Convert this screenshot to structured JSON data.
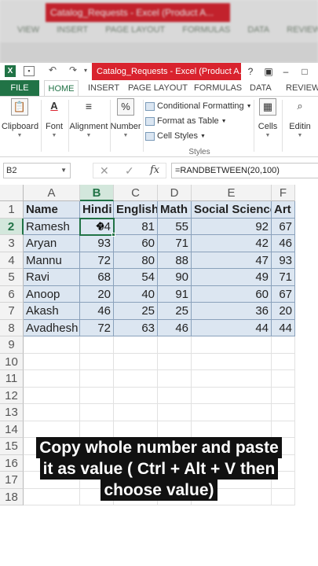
{
  "backdrop": {
    "title": "Catalog_Requests - Excel (Product A...",
    "tabs": [
      "VIEW",
      "INSERT",
      "PAGE LAYOUT",
      "FORMULAS",
      "DATA",
      "REVIEW"
    ]
  },
  "window": {
    "title": "Catalog_Requests - Excel (Product A...",
    "help": "?",
    "brand_color": "#217346",
    "title_color": "#d9232e"
  },
  "tabs": [
    "FILE",
    "HOME",
    "INSERT",
    "PAGE LAYOUT",
    "FORMULAS",
    "DATA",
    "REVIEW"
  ],
  "ribbon": {
    "clipboard": "Clipboard",
    "font": "Font",
    "alignment": "Alignment",
    "number": "Number",
    "conditional_formatting": "Conditional Formatting",
    "format_as_table": "Format as Table",
    "cell_styles": "Cell Styles",
    "styles": "Styles",
    "cells": "Cells",
    "editing": "Editin"
  },
  "formula_bar": {
    "name_box": "B2",
    "formula": "=RANDBETWEEN(20,100)"
  },
  "sheet": {
    "columns": [
      "A",
      "B",
      "C",
      "D",
      "E",
      "F"
    ],
    "row_numbers": [
      "1",
      "2",
      "3",
      "4",
      "5",
      "6",
      "7",
      "8",
      "9",
      "10",
      "11",
      "12",
      "13",
      "14",
      "15",
      "16",
      "17",
      "18"
    ],
    "header": [
      "Name",
      "Hindi",
      "English",
      "Math",
      "Social Science",
      "Art"
    ],
    "rows": [
      [
        "Ramesh",
        "94",
        "81",
        "55",
        "92",
        "67"
      ],
      [
        "Aryan",
        "93",
        "60",
        "71",
        "42",
        "46"
      ],
      [
        "Mannu",
        "72",
        "80",
        "88",
        "47",
        "93"
      ],
      [
        "Ravi",
        "68",
        "54",
        "90",
        "49",
        "71"
      ],
      [
        "Anoop",
        "20",
        "40",
        "91",
        "60",
        "67"
      ],
      [
        "Akash",
        "46",
        "25",
        "25",
        "36",
        "20"
      ],
      [
        "Avadhesh",
        "72",
        "63",
        "46",
        "44",
        "44"
      ]
    ]
  },
  "caption": {
    "lines": [
      "Copy whole number and paste",
      "it as value ( Ctrl + Alt + V then",
      "choose value)"
    ]
  }
}
